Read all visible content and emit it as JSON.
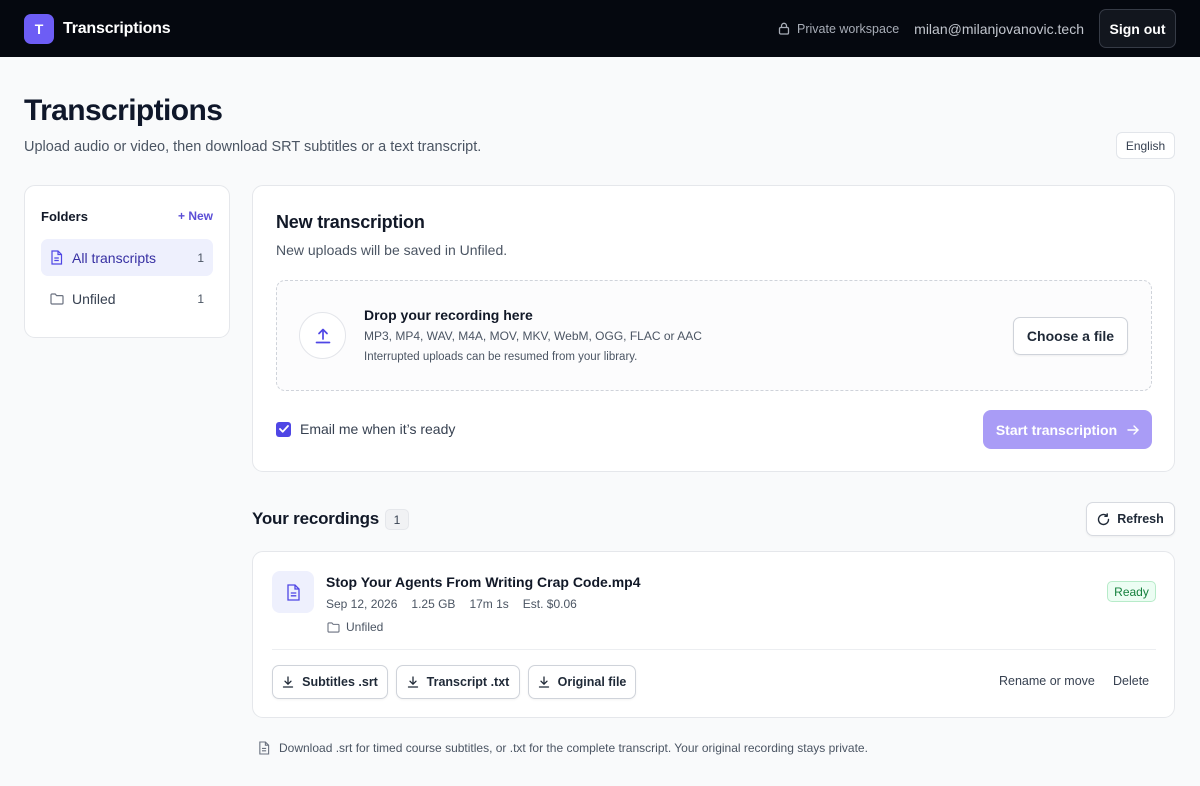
{
  "topbar": {
    "logo_letter": "T",
    "app_title": "Transcriptions",
    "workspace_label": "Private workspace",
    "user_email": "milan@milanjovanovic.tech",
    "sign_out_label": "Sign out"
  },
  "header": {
    "title": "Transcriptions",
    "subtitle": "Upload audio or video, then download SRT subtitles or a text transcript.",
    "language": "English"
  },
  "folders": {
    "title": "Folders",
    "new_label": "+ New",
    "items": [
      {
        "label": "All transcripts",
        "count": "1"
      },
      {
        "label": "Unfiled",
        "count": "1"
      }
    ]
  },
  "new_transcription": {
    "title": "New transcription",
    "subtitle": "New uploads will be saved in Unfiled.",
    "drop_title": "Drop your recording here",
    "drop_formats": "MP3, MP4, WAV, M4A, MOV, MKV, WebM, OGG, FLAC or AAC",
    "drop_note": "Interrupted uploads can be resumed from your library.",
    "choose_label": "Choose a file",
    "email_label": "Email me when it’s ready",
    "start_label": "Start transcription"
  },
  "recordings": {
    "title": "Your recordings",
    "count": "1",
    "refresh_label": "Refresh",
    "items": [
      {
        "name": "Stop Your Agents From Writing Crap Code.mp4",
        "date": "Sep 12, 2026",
        "size": "1.25 GB",
        "duration": "17m 1s",
        "cost": "Est. $0.06",
        "folder": "Unfiled",
        "status": "Ready",
        "actions": {
          "srt": "Subtitles .srt",
          "txt": "Transcript .txt",
          "original": "Original file",
          "rename": "Rename or move",
          "delete": "Delete"
        }
      }
    ]
  },
  "footer_note": "Download .srt for timed course subtitles, or .txt for the complete transcript. Your original recording stays private.",
  "colors": {
    "accent": "#6d5df5",
    "topbar": "#05080f",
    "start_button": "#a99cf6",
    "ready_text": "#15803d"
  }
}
